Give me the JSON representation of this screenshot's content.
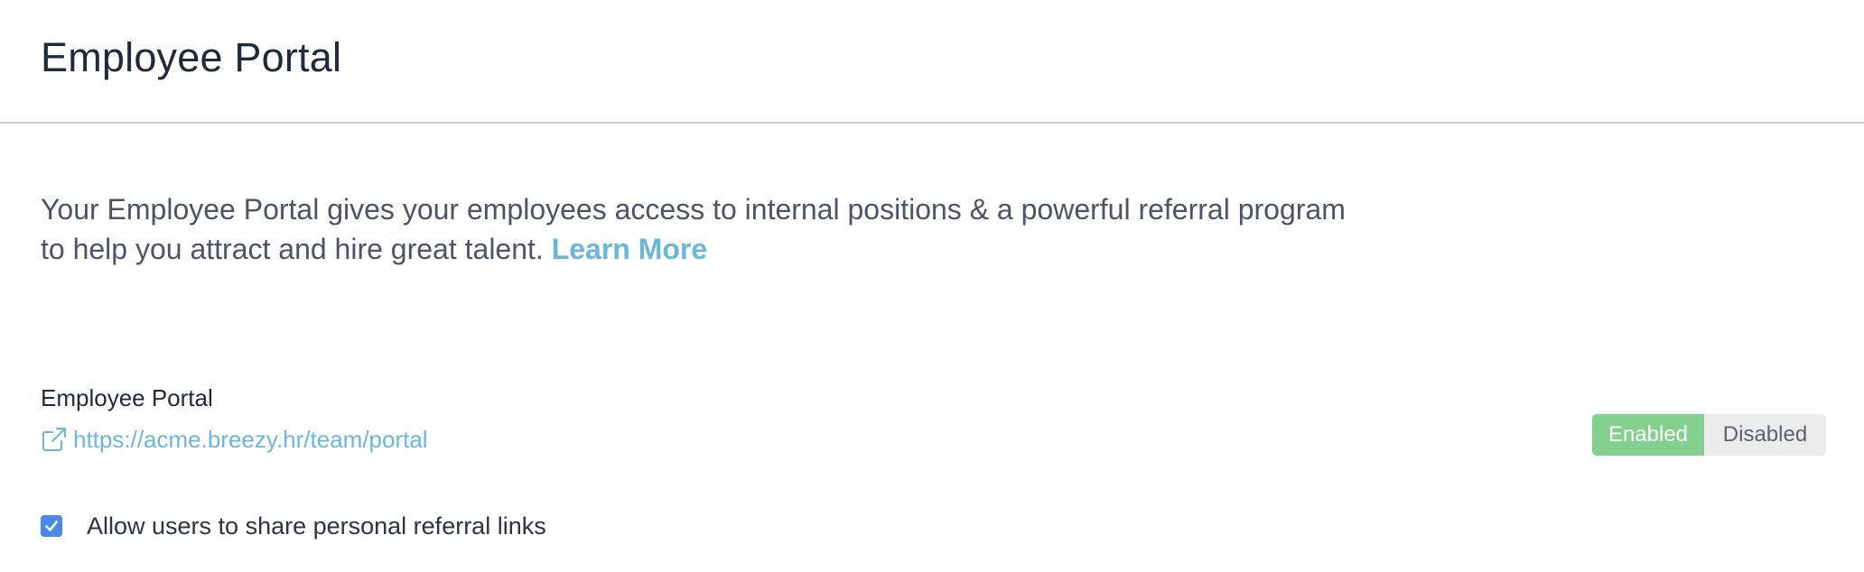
{
  "header": {
    "title": "Employee Portal"
  },
  "intro": {
    "text_line1": "Your Employee Portal gives your employees access to internal positions & a powerful referral program",
    "text_line2": "to help you attract and hire great talent.",
    "learn_more_label": "Learn More"
  },
  "portal_section": {
    "label": "Employee Portal",
    "url": "https://acme.breezy.hr/team/portal",
    "link_icon": "external-link-icon",
    "toggle": {
      "options": [
        "Enabled",
        "Disabled"
      ],
      "selected": "Enabled",
      "enabled_color": "#84d08f",
      "disabled_color": "#ececec"
    }
  },
  "settings": {
    "share_referral_links": {
      "label": "Allow users to share personal referral links",
      "checked": true,
      "checkbox_color": "#4a89e5"
    }
  },
  "colors": {
    "link": "#6bb7dc",
    "title": "#1f2a3b",
    "body_text": "#4b5566",
    "divider": "#c9ccd1"
  }
}
